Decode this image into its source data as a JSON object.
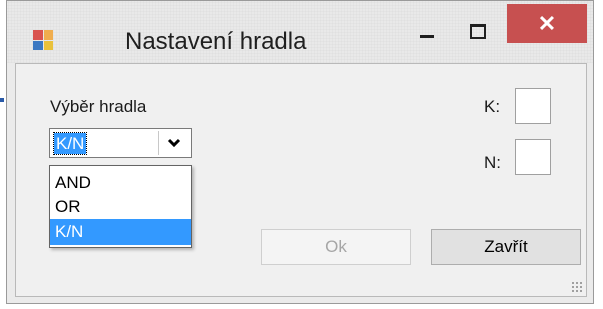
{
  "window": {
    "title": "Nastavení hradla",
    "close_symbol": "✕",
    "icon": "form-icon"
  },
  "form": {
    "gate_label": "Výběr hradla",
    "combo": {
      "selected": "K/N",
      "arrow": "⌵"
    },
    "options": [
      "AND",
      "OR",
      "K/N"
    ],
    "highlighted_option": "K/N",
    "k_label": "K:",
    "n_label": "N:",
    "k_value": "",
    "n_value": ""
  },
  "buttons": {
    "ok_label": "Ok",
    "ok_enabled": false,
    "close_label": "Zavřít"
  },
  "colors": {
    "accent": "#3399ff",
    "close_button": "#c75050",
    "icon_tiles": [
      "#d9534f",
      "#f0ad4e",
      "#3b78c2",
      "#e9c13b"
    ]
  }
}
